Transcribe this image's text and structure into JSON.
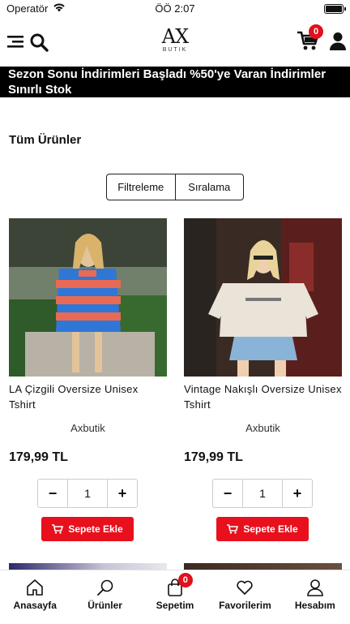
{
  "status": {
    "carrier": "Operatör",
    "time": "ÖÖ 2:07"
  },
  "header": {
    "logo_mark": "AX",
    "logo_sub": "BUTIK",
    "cart_count": "0"
  },
  "banner": {
    "text": "Sezon Sonu İndirimleri Başladı %50'ye Varan İndirimler Sınırlı Stok"
  },
  "page_title": "Tüm Ürünler",
  "filters": {
    "filter_label": "Filtreleme",
    "sort_label": "Sıralama"
  },
  "products": [
    {
      "name": "LA Çizgili Oversize Unisex Tshirt",
      "brand": "Axbutik",
      "price": "179,99 TL",
      "qty": "1",
      "add_label": "Sepete Ekle"
    },
    {
      "name": "Vintage Nakışlı Oversize Unisex Tshirt",
      "brand": "Axbutik",
      "price": "179,99 TL",
      "qty": "1",
      "add_label": "Sepete Ekle"
    }
  ],
  "tabbar": {
    "home": "Anasayfa",
    "products": "Ürünler",
    "cart": "Sepetim",
    "cart_count": "0",
    "favorites": "Favorilerim",
    "account": "Hesabım"
  },
  "colors": {
    "accent": "#e8101c",
    "banner_bg": "#000000"
  }
}
